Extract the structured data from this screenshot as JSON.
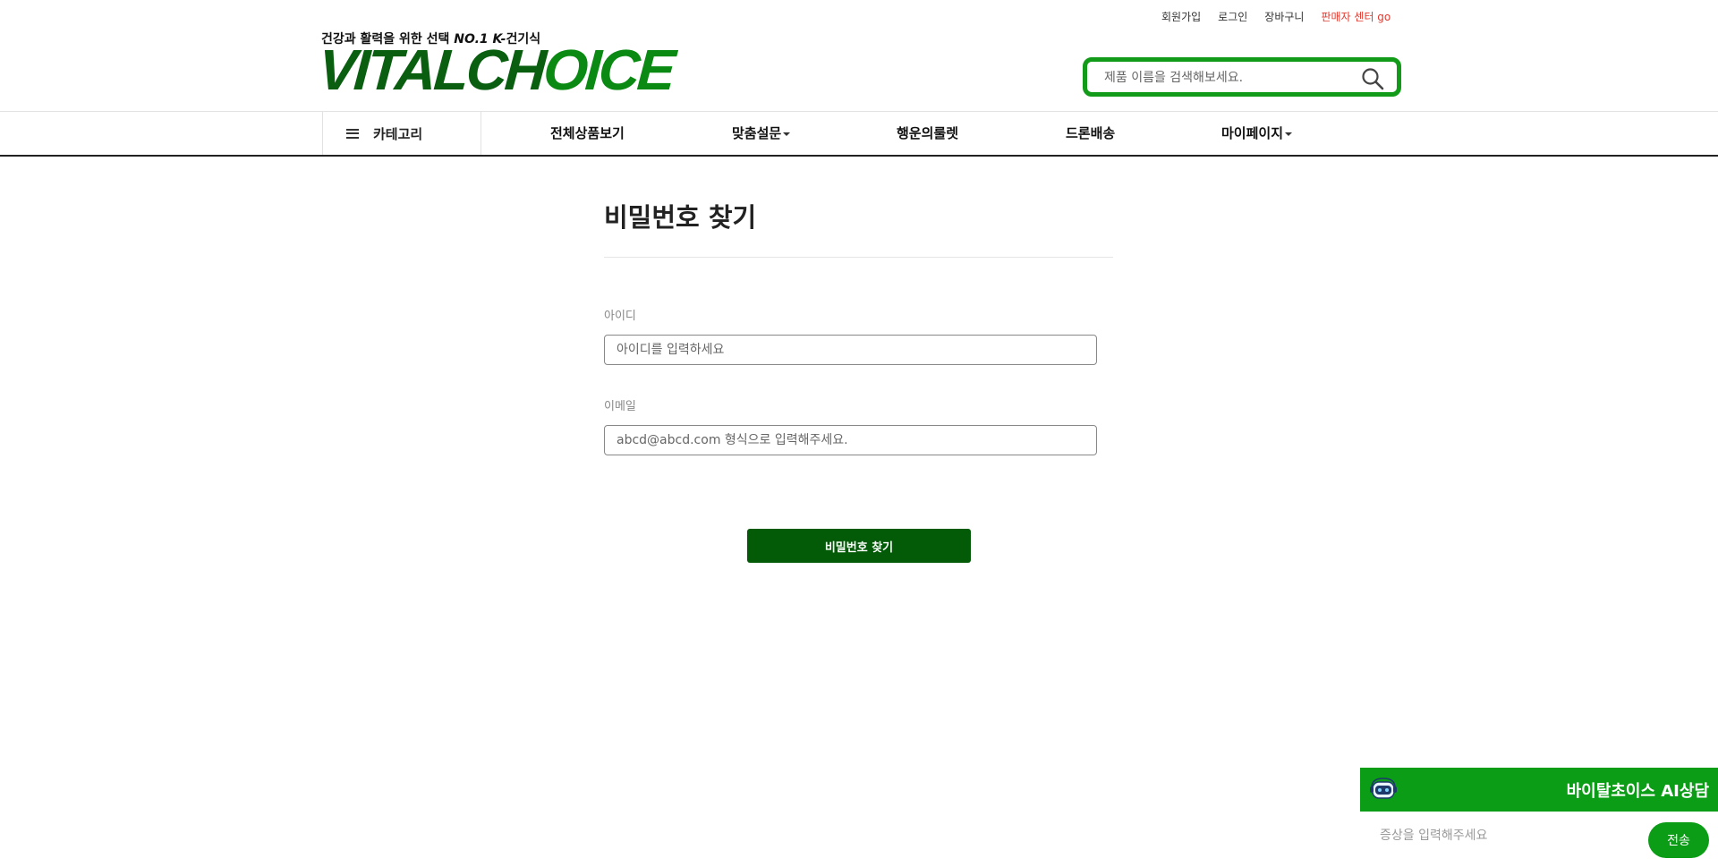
{
  "util_links": {
    "signup": "회원가입",
    "login": "로그인",
    "cart": "장바구니",
    "seller_center": "판매자 센터 go"
  },
  "brand": {
    "tagline_prefix": "건강과 활력을 위한 선택 ",
    "tagline_emph": "NO.1 K-",
    "tagline_suffix": "건기식",
    "logo_part1": "VITALCH",
    "logo_part2": "OICE",
    "logo_full": "VITALCHOICE"
  },
  "search": {
    "placeholder": "제품 이름을 검색해보세요.",
    "icon": "search-icon"
  },
  "nav": {
    "category": "카테고리",
    "items": [
      "전체상품보기",
      "맞춤설문",
      "행운의룰렛",
      "드론배송",
      "마이페이지"
    ]
  },
  "form": {
    "title": "비밀번호 찾기",
    "id_label": "아이디",
    "id_placeholder": "아이디를 입력하세요",
    "email_label": "이메일",
    "email_placeholder": "abcd@abcd.com 형식으로 입력해주세요.",
    "submit": "비밀번호 찾기"
  },
  "chat": {
    "title": "바이탈초이스 AI상담",
    "input_placeholder": "증상을 입력해주세요",
    "send": "전송",
    "icon": "chatbot-icon"
  },
  "colors": {
    "brand_green": "#0b9d16",
    "dark_green": "#035b07",
    "seller_red": "#e03a2f"
  }
}
